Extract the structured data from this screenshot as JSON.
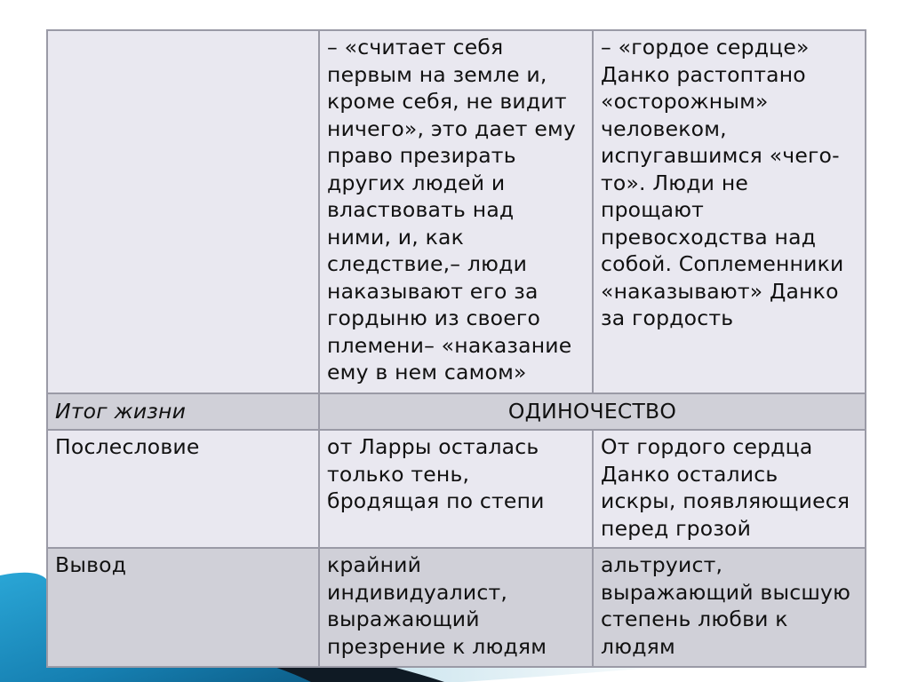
{
  "slide": {
    "accent_colors": {
      "swoosh_blue": "#1b8cc0",
      "swoosh_dark": "#0f1a24",
      "swoosh_light": "#cfe6ef",
      "row_light": "#e9e8f0",
      "row_dark": "#d0d0d8",
      "border": "#9a9aa6"
    }
  },
  "table": {
    "rows": [
      {
        "label": "",
        "larra": "– «считает себя первым на земле и, кроме себя, не видит ничего», это дает ему право презирать других людей и властвовать над ними, и, как следствие,– люди наказывают его за гордыню из своего племени– «наказание ему в нем самом»",
        "danko": "– «гордое сердце» Данко растоптано «осторожным» человеком, испугавшимся «чего-то». Люди не прощают превосходства над собой. Соплеменники «наказывают» Данко за гордость"
      },
      {
        "label": "Итог жизни",
        "merged": "ОДИНОЧЕСТВО"
      },
      {
        "label": "Послесловие",
        "larra": "от Ларры осталась только тень, бродящая по степи",
        "danko": "От гордого сердца Данко остались искры, появляющиеся перед грозой"
      },
      {
        "label": "Вывод",
        "larra": "крайний индивидуалист, выражающий презрение к людям",
        "danko": "альтруист, выражающий высшую степень любви к людям"
      }
    ]
  }
}
